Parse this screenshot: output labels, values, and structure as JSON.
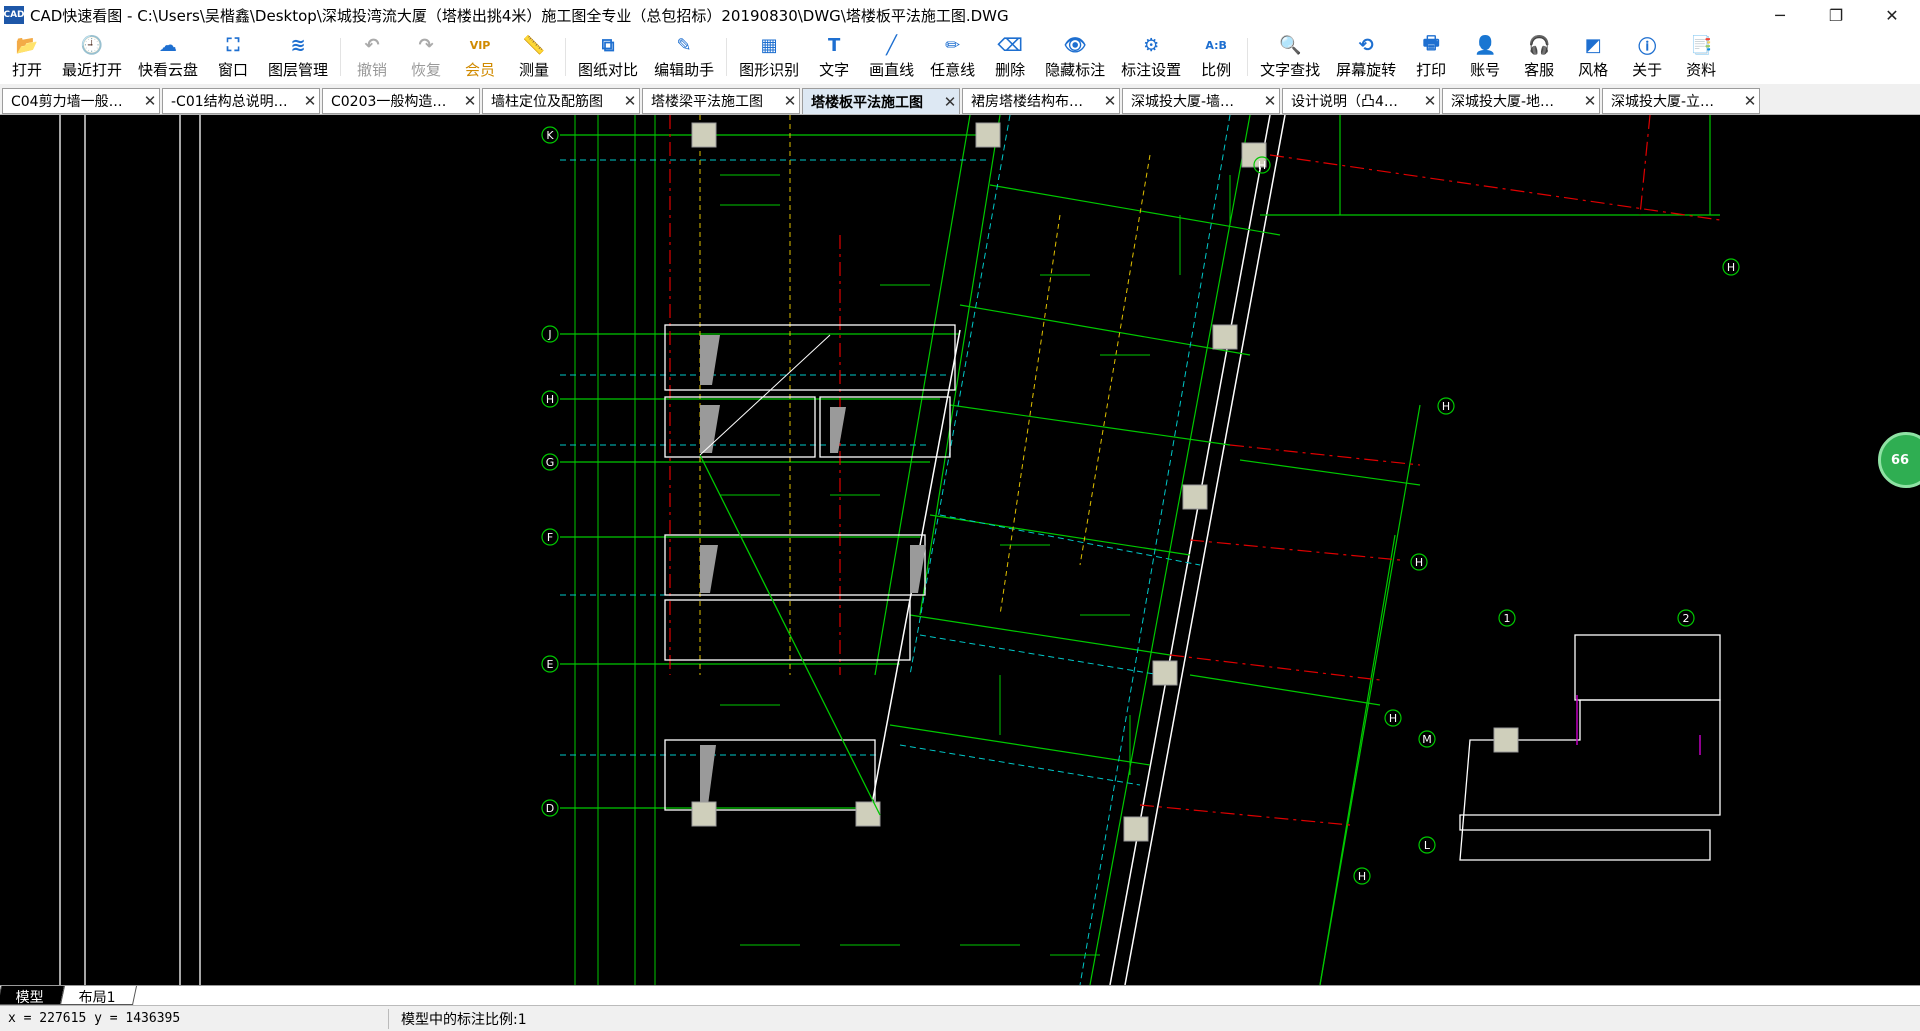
{
  "window": {
    "logo_text": "CAD",
    "title": "CAD快速看图 - C:\\Users\\吴楷鑫\\Desktop\\深城投湾流大厦（塔楼出挑4米）施工图全专业（总包招标）20190830\\DWG\\塔楼板平法施工图.DWG",
    "min": "─",
    "max": "❐",
    "close": "✕"
  },
  "toolbar": [
    {
      "name": "open",
      "label": "打开",
      "icon": "📂"
    },
    {
      "name": "recent",
      "label": "最近打开",
      "icon": "🕘"
    },
    {
      "name": "cloud",
      "label": "快看云盘",
      "icon": "☁"
    },
    {
      "name": "window",
      "label": "窗口",
      "icon": "⛶"
    },
    {
      "name": "layers",
      "label": "图层管理",
      "icon": "≋"
    },
    {
      "name": "undo",
      "label": "撤销",
      "icon": "↶",
      "disabled": true
    },
    {
      "name": "redo",
      "label": "恢复",
      "icon": "↷",
      "disabled": true
    },
    {
      "name": "vip",
      "label": "会员",
      "icon": "VIP",
      "vip": true
    },
    {
      "name": "measure",
      "label": "测量",
      "icon": "📏"
    },
    {
      "name": "compare",
      "label": "图纸对比",
      "icon": "⧉"
    },
    {
      "name": "edit",
      "label": "编辑助手",
      "icon": "✎"
    },
    {
      "name": "shape",
      "label": "图形识别",
      "icon": "▦"
    },
    {
      "name": "text",
      "label": "文字",
      "icon": "T"
    },
    {
      "name": "line",
      "label": "画直线",
      "icon": "╱"
    },
    {
      "name": "freeline",
      "label": "任意线",
      "icon": "✏"
    },
    {
      "name": "delete",
      "label": "删除",
      "icon": "⌫"
    },
    {
      "name": "hide",
      "label": "隐藏标注",
      "icon": "👁"
    },
    {
      "name": "annot",
      "label": "标注设置",
      "icon": "⚙"
    },
    {
      "name": "scale",
      "label": "比例",
      "icon": "A:B"
    },
    {
      "name": "find",
      "label": "文字查找",
      "icon": "🔍"
    },
    {
      "name": "rotate",
      "label": "屏幕旋转",
      "icon": "⟲"
    },
    {
      "name": "print",
      "label": "打印",
      "icon": "🖶"
    },
    {
      "name": "account",
      "label": "账号",
      "icon": "👤"
    },
    {
      "name": "service",
      "label": "客服",
      "icon": "🎧"
    },
    {
      "name": "style",
      "label": "风格",
      "icon": "◩"
    },
    {
      "name": "about",
      "label": "关于",
      "icon": "ⓘ"
    },
    {
      "name": "docs",
      "label": "资料",
      "icon": "📑"
    }
  ],
  "tabs": [
    {
      "label": "C04剪力墙一般…",
      "active": false
    },
    {
      "label": "-C01结构总说明…",
      "active": false
    },
    {
      "label": "C0203一般构造…",
      "active": false
    },
    {
      "label": "墙柱定位及配筋图",
      "active": false
    },
    {
      "label": "塔楼梁平法施工图",
      "active": false
    },
    {
      "label": "塔楼板平法施工图",
      "active": true
    },
    {
      "label": "裙房塔楼结构布…",
      "active": false
    },
    {
      "label": "深城投大厦-墙…",
      "active": false
    },
    {
      "label": "设计说明（凸4…",
      "active": false
    },
    {
      "label": "深城投大厦-地…",
      "active": false
    },
    {
      "label": "深城投大厦-立…",
      "active": false
    }
  ],
  "tab_close": "✕",
  "drawing": {
    "grid_labels": [
      "K",
      "J",
      "H",
      "G",
      "F",
      "E",
      "D"
    ],
    "right_grid_labels": [
      "M",
      "L"
    ],
    "column_labels": [
      "1",
      "2"
    ],
    "slant_labels": [
      "H",
      "H",
      "H",
      "H",
      "H",
      "H"
    ],
    "colors": {
      "green": "#00c800",
      "cyan": "#00c8c8",
      "red": "#e00000",
      "yellow": "#e0c000",
      "white": "#ffffff",
      "magenta": "#c000c0"
    }
  },
  "float_badge": "66",
  "layout_tabs": [
    {
      "label": "模型",
      "active": true
    },
    {
      "label": "布局1",
      "active": false
    }
  ],
  "status": {
    "coords": "x = 227615  y = 1436395",
    "scale_text": "模型中的标注比例:1"
  }
}
